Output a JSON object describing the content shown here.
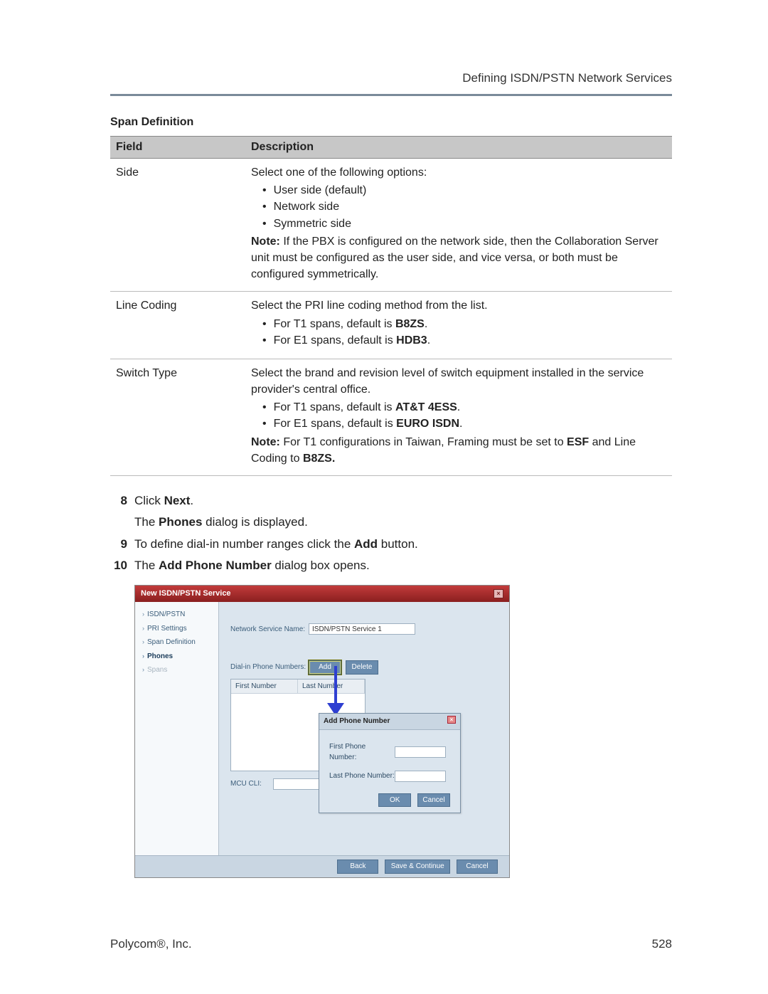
{
  "header": {
    "title": "Defining ISDN/PSTN Network Services"
  },
  "table": {
    "caption": "Span Definition",
    "col_field": "Field",
    "col_desc": "Description",
    "rows": [
      {
        "field": "Side",
        "intro": "Select one of the following options:",
        "b1": "User side (default)",
        "b2": "Network side",
        "b3": "Symmetric side",
        "note_label": "Note:",
        "note_rest": " If the PBX is configured on the network side, then the Collaboration Server unit must be configured as the user side, and vice versa, or both must be configured symmetrically."
      },
      {
        "field": "Line Coding",
        "intro": "Select the PRI line coding method from the list.",
        "b1_pre": "For T1 spans, default is ",
        "b1_bold": "B8ZS",
        "b1_post": ".",
        "b2_pre": "For E1 spans, default is ",
        "b2_bold": "HDB3",
        "b2_post": "."
      },
      {
        "field": "Switch Type",
        "intro": "Select the brand and revision level of switch equipment installed in the service provider's central office.",
        "b1_pre": "For T1 spans, default is ",
        "b1_bold": "AT&T 4ESS",
        "b1_post": ".",
        "b2_pre": "For E1 spans, default is ",
        "b2_bold": "EURO ISDN",
        "b2_post": ".",
        "note_label": "Note:",
        "note_mid1": " For T1 configurations in Taiwan, Framing must be set to ",
        "note_b1": "ESF",
        "note_mid2": " and Line Coding to ",
        "note_b2": "B8ZS."
      }
    ]
  },
  "steps": {
    "s8_num": "8",
    "s8_pre": "Click ",
    "s8_bold": "Next",
    "s8_post": ".",
    "s8_sub_pre": "The ",
    "s8_sub_bold": "Phones",
    "s8_sub_post": " dialog is displayed.",
    "s9_num": "9",
    "s9_pre": "To define dial-in number ranges click the ",
    "s9_bold": "Add",
    "s9_post": " button.",
    "s10_num": "10",
    "s10_pre": "The ",
    "s10_bold": "Add Phone Number",
    "s10_post": " dialog box opens."
  },
  "dialog": {
    "title": "New ISDN/PSTN Service",
    "sidebar": {
      "i0": "ISDN/PSTN",
      "i1": "PRI Settings",
      "i2": "Span Definition",
      "i3": "Phones",
      "i4": "Spans"
    },
    "main": {
      "nsn_label": "Network Service Name:",
      "nsn_value": "ISDN/PSTN Service 1",
      "dialin_label": "Dial-in Phone Numbers:",
      "add_btn": "Add",
      "delete_btn": "Delete",
      "col_first": "First Number",
      "col_last": "Last Number",
      "mcu_label": "MCU CLI:"
    },
    "popup": {
      "title": "Add Phone Number",
      "first_label": "First Phone Number:",
      "last_label": "Last Phone Number:",
      "ok": "OK",
      "cancel": "Cancel"
    },
    "footer": {
      "back": "Back",
      "save": "Save & Continue",
      "cancel": "Cancel"
    }
  },
  "footer": {
    "company": "Polycom®, Inc.",
    "page": "528"
  }
}
